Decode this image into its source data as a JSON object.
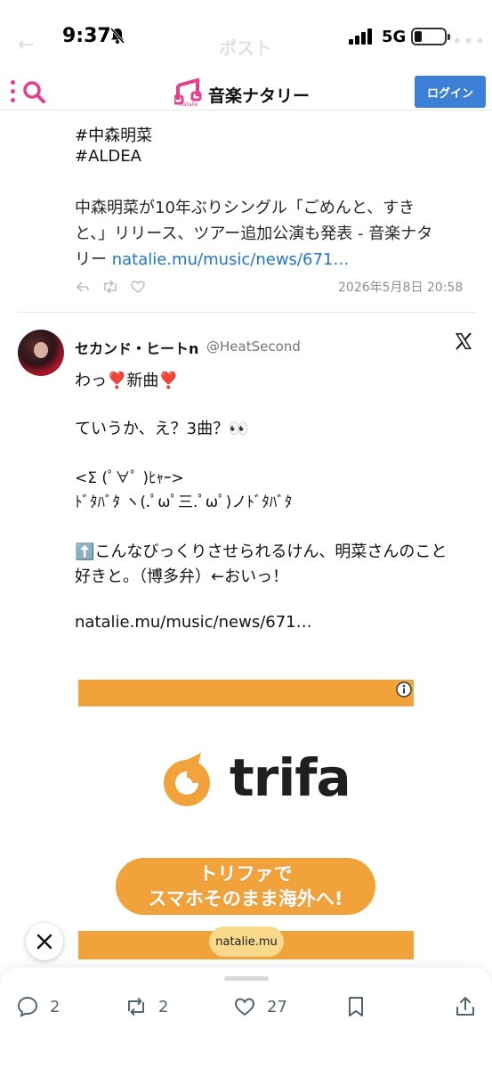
{
  "status_bar": {
    "time": "9:37",
    "network": "5G",
    "ghost_title": "ポスト",
    "ghost_more": "•••"
  },
  "header": {
    "logo_text": "音楽ナタリー",
    "logo_sub": "natalie",
    "login_label": "ログイン",
    "brand_color": "#e83e8c",
    "login_color": "#3b7fd6"
  },
  "quoted_post": {
    "hashtag_1": "#中森明菜",
    "hashtag_2": "#ALDEA",
    "text_line_1": "中森明菜が10年ぶりシングル「ごめんと、すき",
    "text_line_2": "と、」リリース、ツアー追加公演も発表 - 音楽ナタ",
    "text_line_3_prefix": "リー ",
    "link": "natalie.mu/music/news/671…",
    "date": "2026年5月8日 20:58"
  },
  "post": {
    "username": "セカンド・ヒートn",
    "handle": "@HeatSecond",
    "line_1": "わっ❣️新曲❣️",
    "line_2": "ていうか、え？3曲？👀",
    "line_3": "<Σ (ﾟ∀ﾟ )ﾋｬｰ>",
    "line_4": "ﾄﾞﾀﾊﾞﾀ ヽ(.ﾟωﾟ三.ﾟωﾟ)ノﾄﾞﾀﾊﾞﾀ",
    "line_5": "⬆️こんなびっくりさせられるけん、明菜さんのこと",
    "line_6": "好きと。（博多弁）←おいっ！",
    "link": "natalie.mu/music/news/671…"
  },
  "ad": {
    "brand": "trifa",
    "pill_line_1": "トリファで",
    "pill_line_2": "スマホそのまま海外へ!",
    "accent_color": "#f2a23a"
  },
  "overlay": {
    "domain_chip": "natalie.mu"
  },
  "actions": {
    "reply_count": "2",
    "repost_count": "2",
    "like_count": "27"
  }
}
